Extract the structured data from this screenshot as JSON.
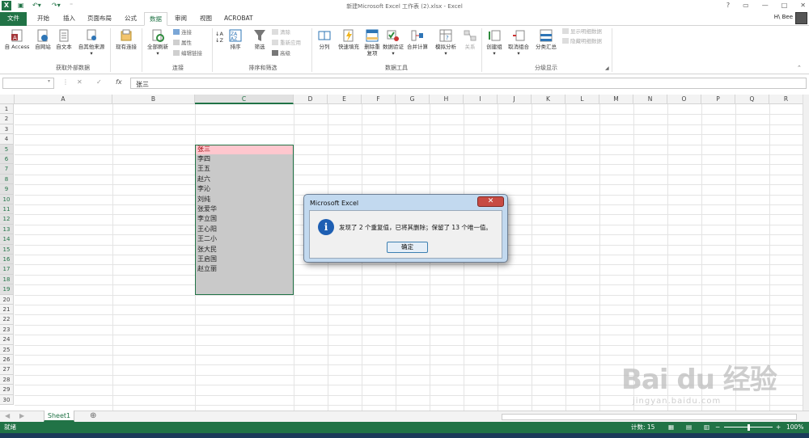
{
  "window": {
    "title": "新建Microsoft Excel 工作表 (2).xlsx - Excel",
    "user": "H\\ Bee"
  },
  "qat": {
    "logo": "X",
    "icons": [
      "save-icon",
      "undo-icon",
      "redo-icon",
      "customize-icon"
    ]
  },
  "tabs": [
    {
      "label": "文件"
    },
    {
      "label": "开始"
    },
    {
      "label": "插入"
    },
    {
      "label": "页面布局"
    },
    {
      "label": "公式"
    },
    {
      "label": "数据"
    },
    {
      "label": "审阅"
    },
    {
      "label": "视图"
    },
    {
      "label": "ACROBAT"
    }
  ],
  "ribbon": {
    "get_external": {
      "buttons": [
        "自 Access",
        "自网站",
        "自文本",
        "自其他来源",
        "现有连接"
      ],
      "label": "获取外部数据"
    },
    "connections": {
      "refresh": "全部刷新",
      "items": [
        "连接",
        "属性",
        "编辑链接"
      ],
      "label": "连接"
    },
    "sort_filter": {
      "sort": "排序",
      "filter": "筛选",
      "items": [
        "清除",
        "重新应用",
        "高级"
      ],
      "label": "排序和筛选"
    },
    "data_tools": {
      "buttons": [
        "分列",
        "快速填充",
        "删除重复项",
        "数据验证",
        "合并计算",
        "模拟分析",
        "关系"
      ],
      "label": "数据工具"
    },
    "outline": {
      "buttons": [
        "创建组",
        "取消组合",
        "分类汇总"
      ],
      "items": [
        "显示明细数据",
        "隐藏明细数据"
      ],
      "label": "分级显示"
    }
  },
  "formula_bar": {
    "name_box": "",
    "fx": "fx",
    "value": "张三"
  },
  "columns": [
    "A",
    "B",
    "C",
    "D",
    "E",
    "F",
    "G",
    "H",
    "I",
    "J",
    "K",
    "L",
    "M",
    "N",
    "O",
    "P",
    "Q",
    "R"
  ],
  "rows": [
    "1",
    "2",
    "3",
    "4",
    "5",
    "6",
    "7",
    "8",
    "9",
    "10",
    "11",
    "12",
    "13",
    "14",
    "15",
    "16",
    "17",
    "18",
    "19",
    "20",
    "21",
    "22",
    "23",
    "24",
    "25",
    "26",
    "27",
    "28",
    "29",
    "30"
  ],
  "cells": [
    "张三",
    "李四",
    "王五",
    "赵六",
    "李沁",
    "刘纯",
    "张爱华",
    "李立国",
    "王心阳",
    "王二小",
    "张大民",
    "王启国",
    "赵立丽"
  ],
  "dialog": {
    "title": "Microsoft Excel",
    "close": "✕",
    "icon": "info-icon",
    "message": "发现了 2 个重复值，已将其删除；保留了 13 个唯一值。",
    "ok": "确定"
  },
  "sheet": {
    "name": "Sheet1",
    "add": "⊕"
  },
  "status": {
    "ready": "就绪",
    "count": "计数: 15",
    "zoom": "100%"
  },
  "watermark": {
    "brand": "Bai du 经验",
    "url": "jingyan.baidu.com"
  }
}
